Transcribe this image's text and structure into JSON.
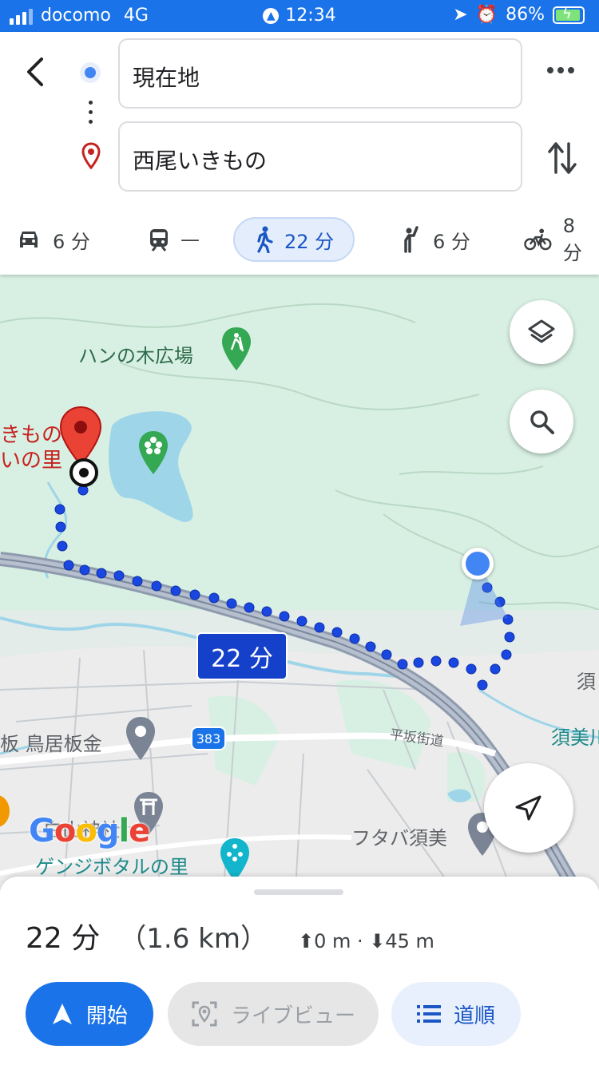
{
  "status_bar": {
    "carrier": "docomo",
    "network": "4G",
    "time": "12:34",
    "battery_percent": "86%"
  },
  "directions": {
    "origin": "現在地",
    "destination": "西尾いきもの"
  },
  "modes": [
    {
      "icon": "car-icon",
      "label": "6 分"
    },
    {
      "icon": "train-icon",
      "label": "—"
    },
    {
      "icon": "walk-icon",
      "label": "22 分",
      "active": true
    },
    {
      "icon": "ride-hail-icon",
      "label": "6 分"
    },
    {
      "icon": "bicycle-icon",
      "label": "8 分"
    }
  ],
  "map": {
    "labels": {
      "park": "ハンの木広場",
      "destination_part1": "きもの",
      "destination_part2": "いの里",
      "place_torii": "板 鳥居板金",
      "shrine": "白山神社",
      "hotaru": "ゲンジボタルの里",
      "futaba": "フタバ須美",
      "street": "平坂街道",
      "sumi_river": "須美川",
      "sumi": "須"
    },
    "route_badge": "383",
    "duration_tag": "22 分",
    "logo": "Google"
  },
  "summary": {
    "time": "22 分",
    "distance": "（1.6 km）",
    "elevation": "⬆0 m · ⬇45 m"
  },
  "buttons": {
    "start": "開始",
    "live_view": "ライブビュー",
    "steps": "道順"
  },
  "colors": {
    "accent": "#1a73e8",
    "route": "#1a47e0",
    "map_green": "#d8f0e3",
    "water": "#9fd5e8"
  }
}
